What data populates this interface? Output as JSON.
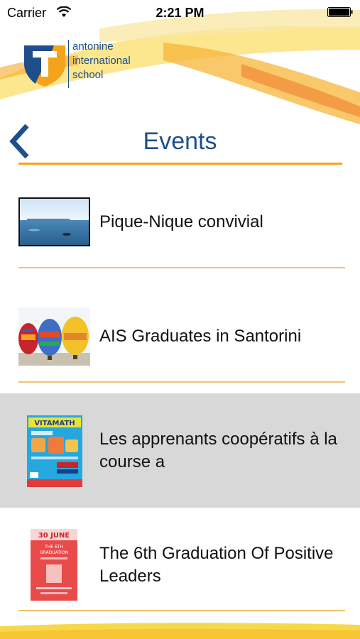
{
  "status_bar": {
    "carrier": "Carrier",
    "time": "2:21 PM"
  },
  "header": {
    "school_name": [
      "antonine",
      "international",
      "school"
    ],
    "title": "Events",
    "colors": {
      "brand_blue": "#1e4e8c",
      "accent_orange": "#f5a31a",
      "accent_yellow": "#f7d84a"
    }
  },
  "events": [
    {
      "title": "Pique-Nique convivial",
      "thumb": "lake-photo"
    },
    {
      "title": "AIS Graduates in Santorini",
      "thumb": "hot-air-balloons-photo"
    },
    {
      "title": "Les apprenants coopératifs à la course a",
      "thumb": "vitamath-poster",
      "selected": true,
      "poster_text": "VITAMATH"
    },
    {
      "title": "The 6th Graduation Of Positive Leaders",
      "thumb": "graduation-poster",
      "poster_text": [
        "30 JUNE",
        "THE 6TH",
        "GRADUATION"
      ]
    }
  ]
}
